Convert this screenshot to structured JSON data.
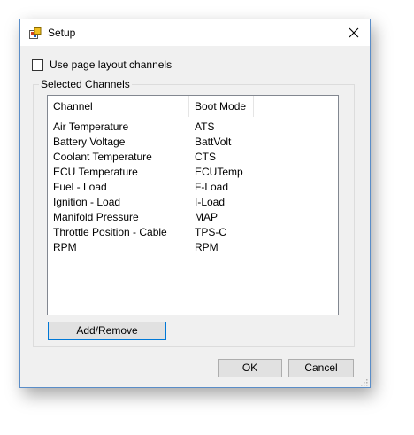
{
  "window": {
    "title": "Setup",
    "icons": {
      "app": "setup-app-icon",
      "close": "close-icon"
    }
  },
  "options": {
    "use_page_layout_label": "Use page layout channels",
    "use_page_layout_checked": false
  },
  "group": {
    "title": "Selected Channels"
  },
  "list": {
    "columns": [
      "Channel",
      "Boot Mode"
    ],
    "rows": [
      [
        "Air Temperature",
        "ATS"
      ],
      [
        "Battery Voltage",
        "BattVolt"
      ],
      [
        "Coolant Temperature",
        "CTS"
      ],
      [
        "ECU Temperature",
        "ECUTemp"
      ],
      [
        "Fuel - Load",
        "F-Load"
      ],
      [
        "Ignition - Load",
        "I-Load"
      ],
      [
        "Manifold Pressure",
        "MAP"
      ],
      [
        "Throttle Position - Cable",
        "TPS-C"
      ],
      [
        "RPM",
        "RPM"
      ]
    ]
  },
  "buttons": {
    "add_remove": "Add/Remove",
    "ok": "OK",
    "cancel": "Cancel"
  },
  "colors": {
    "window_border": "#5a8dc8",
    "dialog_bg": "#f0f0f0",
    "focus_border": "#0078d7"
  }
}
